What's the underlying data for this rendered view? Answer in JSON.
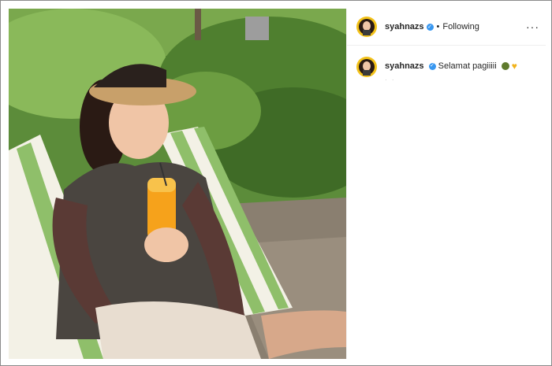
{
  "post": {
    "username": "syahnazs",
    "separator": "•",
    "follow_status": "Following",
    "more_glyph": "···",
    "caption": {
      "username": "syahnazs",
      "text": "Selamat pagiiiii",
      "heart": "♥"
    },
    "time_hint": "· ·"
  },
  "colors": {
    "verified": "#3897f0",
    "avatar_bg": "#f3c21a",
    "heart": "#f1b31c"
  }
}
